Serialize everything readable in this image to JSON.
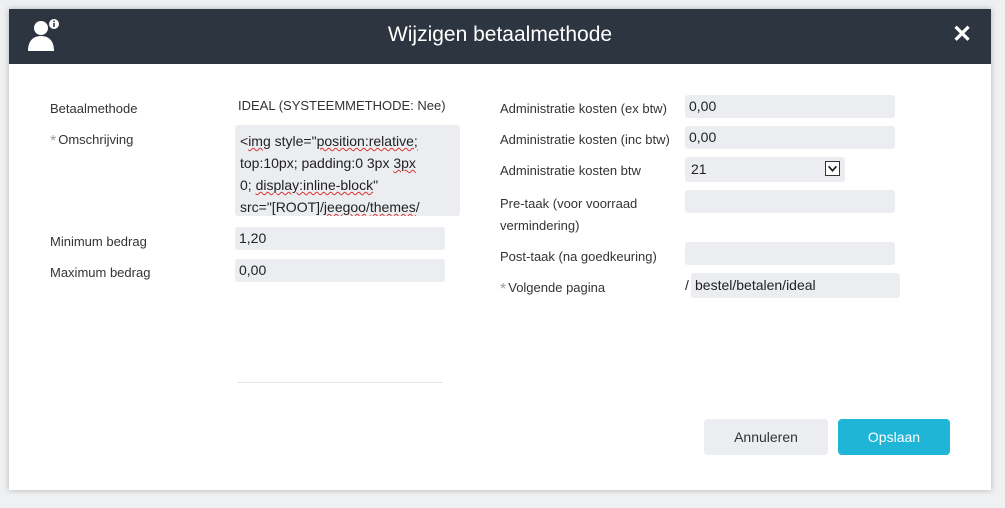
{
  "dialog": {
    "title": "Wijzigen betaalmethode",
    "close_label": "✕"
  },
  "left": {
    "betaalmethode_label": "Betaalmethode",
    "betaalmethode_value": "IDEAL (SYSTEEMMETHODE: Nee)",
    "omschrijving_label": "Omschrijving",
    "omschrijving_lines": [
      [
        "<",
        "img",
        " style=\"",
        "position:relative;",
        ""
      ],
      [
        "top:10px; padding:0 3px ",
        "3px",
        ""
      ],
      [
        "0; ",
        "display:inline-block",
        "\""
      ],
      [
        "src=\"[ROOT]/",
        "jeegoo",
        "/",
        "themes",
        "/"
      ]
    ],
    "minimum_label": "Minimum bedrag",
    "minimum_value": "1,20",
    "maximum_label": "Maximum bedrag",
    "maximum_value": "0,00"
  },
  "right": {
    "admin_ex_label": "Administratie kosten (ex btw)",
    "admin_ex_value": "0,00",
    "admin_inc_label": "Administratie kosten (inc btw)",
    "admin_inc_value": "0,00",
    "admin_btw_label": "Administratie kosten btw",
    "admin_btw_value": "21",
    "pre_taak_label_line1": "Pre-taak (voor voorraad",
    "pre_taak_label_line2": "vermindering)",
    "pre_taak_value": "",
    "post_taak_label": "Post-taak (na goedkeuring)",
    "post_taak_value": "",
    "volgende_label": "Volgende pagina",
    "volgende_prefix": "/",
    "volgende_value": "bestel/betalen/ideal"
  },
  "buttons": {
    "cancel": "Annuleren",
    "save": "Opslaan"
  },
  "required_marker": "*",
  "colors": {
    "titlebar": "#2d3540",
    "primary": "#1eb5d6",
    "field_bg": "#ebedf0"
  }
}
